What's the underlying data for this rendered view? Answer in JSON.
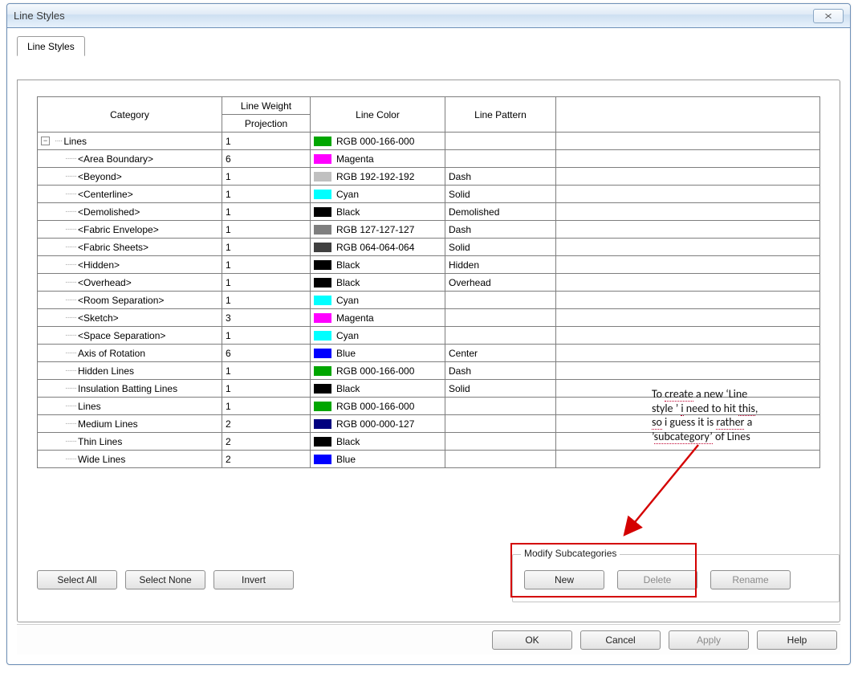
{
  "window": {
    "title": "Line Styles"
  },
  "tab": {
    "label": "Line Styles"
  },
  "columns": {
    "category": "Category",
    "weight_top": "Line Weight",
    "weight_sub": "Projection",
    "color": "Line Color",
    "pattern": "Line Pattern"
  },
  "root": {
    "label": "Lines",
    "weight": "1",
    "color_hex": "#00a600",
    "color_label": "RGB 000-166-000",
    "pattern": ""
  },
  "rows": [
    {
      "label": "<Area Boundary>",
      "weight": "6",
      "color_hex": "#ff00ff",
      "color_label": "Magenta",
      "pattern": ""
    },
    {
      "label": "<Beyond>",
      "weight": "1",
      "color_hex": "#c0c0c0",
      "color_label": "RGB 192-192-192",
      "pattern": "Dash"
    },
    {
      "label": "<Centerline>",
      "weight": "1",
      "color_hex": "#00ffff",
      "color_label": "Cyan",
      "pattern": "Solid"
    },
    {
      "label": "<Demolished>",
      "weight": "1",
      "color_hex": "#000000",
      "color_label": "Black",
      "pattern": "Demolished"
    },
    {
      "label": "<Fabric Envelope>",
      "weight": "1",
      "color_hex": "#7f7f7f",
      "color_label": "RGB 127-127-127",
      "pattern": "Dash"
    },
    {
      "label": "<Fabric Sheets>",
      "weight": "1",
      "color_hex": "#404040",
      "color_label": "RGB 064-064-064",
      "pattern": "Solid"
    },
    {
      "label": "<Hidden>",
      "weight": "1",
      "color_hex": "#000000",
      "color_label": "Black",
      "pattern": "Hidden"
    },
    {
      "label": "<Overhead>",
      "weight": "1",
      "color_hex": "#000000",
      "color_label": "Black",
      "pattern": "Overhead"
    },
    {
      "label": "<Room Separation>",
      "weight": "1",
      "color_hex": "#00ffff",
      "color_label": "Cyan",
      "pattern": ""
    },
    {
      "label": "<Sketch>",
      "weight": "3",
      "color_hex": "#ff00ff",
      "color_label": "Magenta",
      "pattern": ""
    },
    {
      "label": "<Space Separation>",
      "weight": "1",
      "color_hex": "#00ffff",
      "color_label": "Cyan",
      "pattern": ""
    },
    {
      "label": "Axis of Rotation",
      "weight": "6",
      "color_hex": "#0000ff",
      "color_label": "Blue",
      "pattern": "Center"
    },
    {
      "label": "Hidden Lines",
      "weight": "1",
      "color_hex": "#00a600",
      "color_label": "RGB 000-166-000",
      "pattern": "Dash"
    },
    {
      "label": "Insulation Batting Lines",
      "weight": "1",
      "color_hex": "#000000",
      "color_label": "Black",
      "pattern": "Solid"
    },
    {
      "label": "Lines",
      "weight": "1",
      "color_hex": "#00a600",
      "color_label": "RGB 000-166-000",
      "pattern": ""
    },
    {
      "label": "Medium Lines",
      "weight": "2",
      "color_hex": "#00007f",
      "color_label": "RGB 000-000-127",
      "pattern": ""
    },
    {
      "label": "Thin Lines",
      "weight": "2",
      "color_hex": "#000000",
      "color_label": "Black",
      "pattern": ""
    },
    {
      "label": "Wide Lines",
      "weight": "2",
      "color_hex": "#0000ff",
      "color_label": "Blue",
      "pattern": ""
    }
  ],
  "selection_buttons": {
    "select_all": "Select All",
    "select_none": "Select None",
    "invert": "Invert"
  },
  "subcat": {
    "legend": "Modify Subcategories",
    "new": "New",
    "delete": "Delete",
    "rename": "Rename"
  },
  "footer": {
    "ok": "OK",
    "cancel": "Cancel",
    "apply": "Apply",
    "help": "Help"
  },
  "annotation": {
    "l1_a": "To ",
    "l1_b": "create",
    "l1_c": " a new ‘Line",
    "l2_a": "style ’ ",
    "l2_b": "i",
    "l2_c": " need to hit ",
    "l2_d": "this",
    "l2_e": ",",
    "l3_a": "so",
    "l3_b": " i guess it is ",
    "l3_c": "rather",
    "l3_d": " a",
    "l4_a": "’",
    "l4_b": "subcategory’",
    "l4_c": " of Lines"
  }
}
